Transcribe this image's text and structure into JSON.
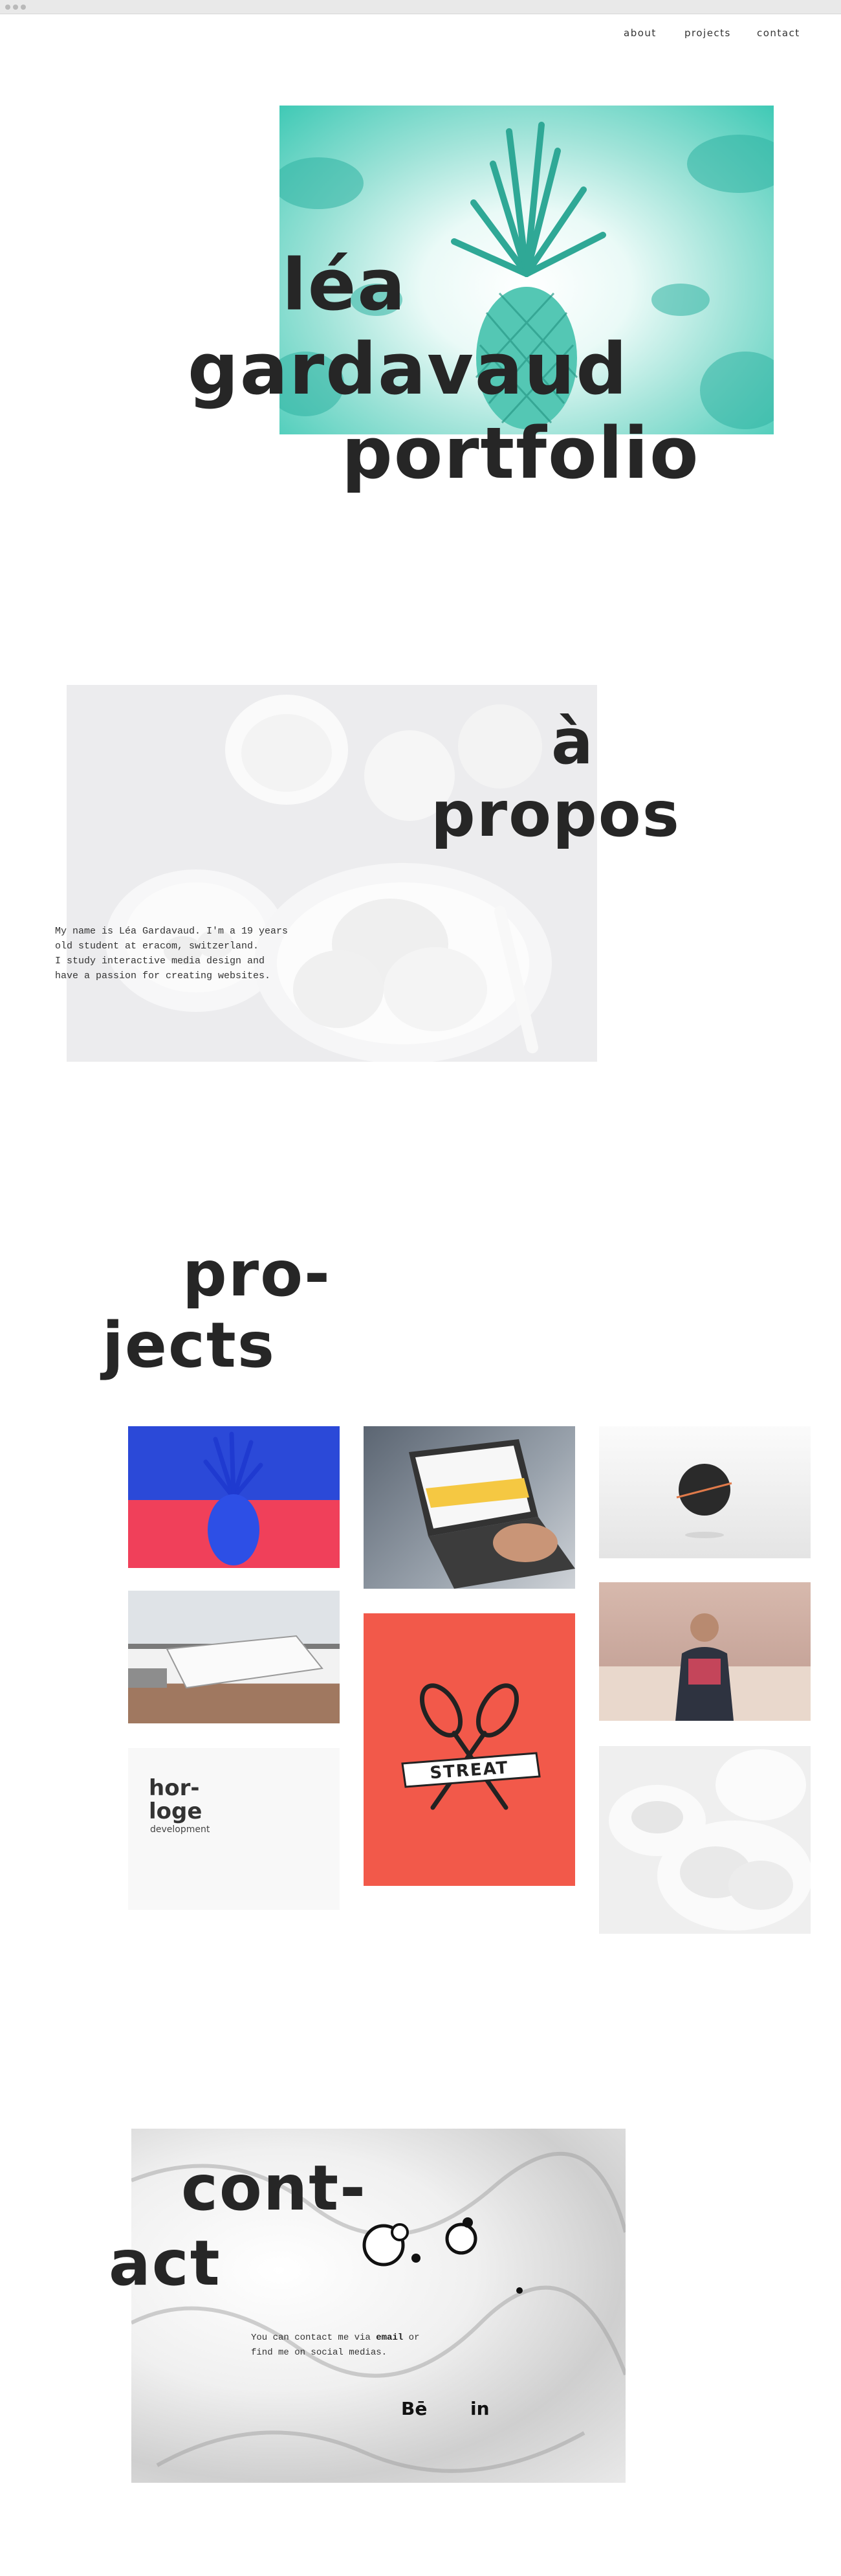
{
  "nav": {
    "about": "about",
    "projects": "projects",
    "contact": "contact"
  },
  "hero": {
    "line1": "léa",
    "line2": "gardavaud",
    "line3": "portfolio"
  },
  "about": {
    "title_line1": "à",
    "title_line2": "propos",
    "text_line1": "My name is Léa Gardavaud. I'm a 19 years",
    "text_line2": "old student at eracom, switzerland.",
    "text_line3": "I study interactive media design and",
    "text_line4": "have a passion for creating websites."
  },
  "projects": {
    "title_line1": "pro-",
    "title_line2": "jects",
    "horloge_line1": "hor-",
    "horloge_line2": "loge",
    "horloge_sub": "development",
    "streat_label": "STREAT"
  },
  "contact": {
    "title_line1": "cont-",
    "title_line2": "act",
    "text_before": "You can contact me via",
    "email_link": "email",
    "text_after": "or",
    "text_line2": "find me on social medias.",
    "behance": "Bē",
    "linkedin": "in"
  },
  "icons": [
    "window-dot-icon",
    "pineapple-icon",
    "whisk-icon",
    "behance-icon",
    "linkedin-icon"
  ],
  "colors": {
    "accent_teal": "#3fc9b5",
    "streat_red": "#f2594a",
    "blue": "#2b49d8",
    "pink": "#f0405a"
  }
}
